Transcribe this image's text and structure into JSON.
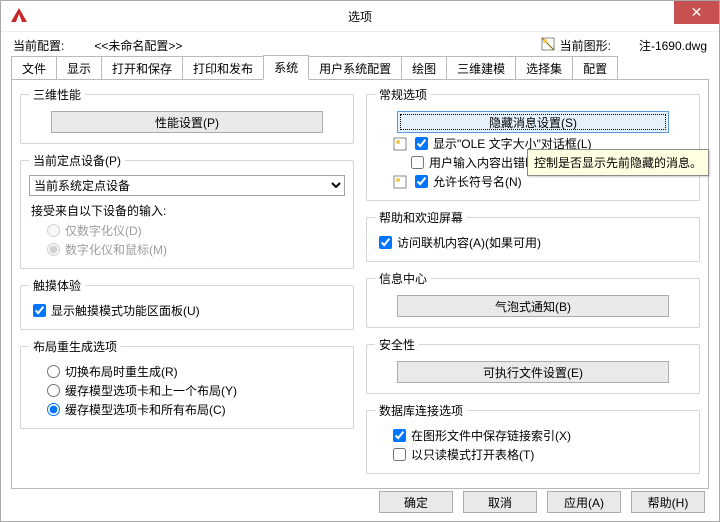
{
  "title": "选项",
  "close_glyph": "✕",
  "profile": {
    "label": "当前配置:",
    "value": "<<未命名配置>>",
    "drawing_label": "当前图形:",
    "drawing_value": "注-1690.dwg"
  },
  "tabs": [
    "文件",
    "显示",
    "打开和保存",
    "打印和发布",
    "系统",
    "用户系统配置",
    "绘图",
    "三维建模",
    "选择集",
    "配置"
  ],
  "active_tab": 4,
  "left": {
    "perf": {
      "legend": "三维性能",
      "btn": "性能设置(P)"
    },
    "pointer": {
      "legend": "当前定点设备(P)",
      "select_value": "当前系统定点设备",
      "accept_label": "接受来自以下设备的输入:",
      "opt_digi": "仅数字化仪(D)",
      "opt_both": "数字化仪和鼠标(M)"
    },
    "touch": {
      "legend": "触摸体验",
      "chk": "显示触摸模式功能区面板(U)"
    },
    "regen": {
      "legend": "布局重生成选项",
      "o1": "切换布局时重生成(R)",
      "o2": "缓存模型选项卡和上一个布局(Y)",
      "o3": "缓存模型选项卡和所有布局(C)"
    }
  },
  "right": {
    "general": {
      "legend": "常规选项",
      "btn": "隐藏消息设置(S)",
      "ole": "显示\"OLE 文字大小\"对话框(L)",
      "beep": "用户输入内容出错时进行声音提示(B)",
      "long": "允许长符号名(N)"
    },
    "help": {
      "legend": "帮助和欢迎屏幕",
      "chk": "访问联机内容(A)(如果可用)"
    },
    "info": {
      "legend": "信息中心",
      "btn": "气泡式通知(B)"
    },
    "sec": {
      "legend": "安全性",
      "btn": "可执行文件设置(E)"
    },
    "db": {
      "legend": "数据库连接选项",
      "c1": "在图形文件中保存链接索引(X)",
      "c2": "以只读模式打开表格(T)"
    }
  },
  "tooltip": "控制是否显示先前隐藏的消息。",
  "footer": {
    "ok": "确定",
    "cancel": "取消",
    "apply": "应用(A)",
    "help": "帮助(H)"
  }
}
